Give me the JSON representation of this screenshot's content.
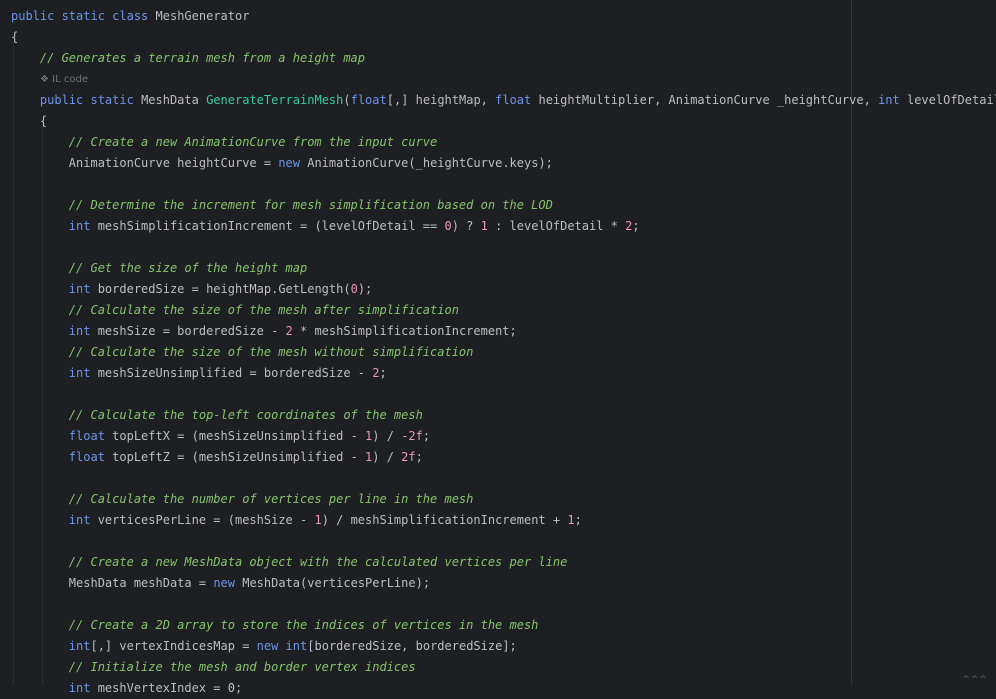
{
  "editor": {
    "inline_hint": {
      "icon": "il-code-icon",
      "label": "IL code"
    },
    "footer_marker": "^^^",
    "lines": [
      [
        [
          "kw",
          "public "
        ],
        [
          "kw",
          "static "
        ],
        [
          "kw",
          "class "
        ],
        [
          "type",
          "MeshGenerator"
        ]
      ],
      [
        [
          "punct",
          "{"
        ]
      ],
      [
        [
          "cmt",
          "    // Generates a terrain mesh from a height map"
        ]
      ],
      "HINT",
      [
        [
          "ident",
          "    "
        ],
        [
          "kw",
          "public "
        ],
        [
          "kw",
          "static "
        ],
        [
          "type",
          "MeshData "
        ],
        [
          "fn",
          "GenerateTerrainMesh"
        ],
        [
          "punct",
          "("
        ],
        [
          "kw",
          "float"
        ],
        [
          "punct",
          "[,] "
        ],
        [
          "ident",
          "heightMap, "
        ],
        [
          "kw",
          "float "
        ],
        [
          "ident",
          "heightMultiplier, "
        ],
        [
          "type",
          "AnimationCurve "
        ],
        [
          "ident",
          "_heightCurve, "
        ],
        [
          "kw",
          "int "
        ],
        [
          "ident",
          "levelOfDetail)"
        ]
      ],
      [
        [
          "punct",
          "    {"
        ]
      ],
      [
        [
          "cmt",
          "        // Create a new AnimationCurve from the input curve"
        ]
      ],
      [
        [
          "ident",
          "        "
        ],
        [
          "type",
          "AnimationCurve "
        ],
        [
          "ident",
          "heightCurve = "
        ],
        [
          "kw",
          "new "
        ],
        [
          "type",
          "AnimationCurve"
        ],
        [
          "punct",
          "("
        ],
        [
          "ident",
          "_heightCurve.keys);"
        ]
      ],
      [],
      [
        [
          "cmt",
          "        // Determine the increment for mesh simplification based on the LOD"
        ]
      ],
      [
        [
          "ident",
          "        "
        ],
        [
          "kw",
          "int "
        ],
        [
          "ident",
          "meshSimplificationIncrement = (levelOfDetail == "
        ],
        [
          "num",
          "0"
        ],
        [
          "ident",
          ") ? "
        ],
        [
          "num",
          "1"
        ],
        [
          "ident",
          " : levelOfDetail * "
        ],
        [
          "num",
          "2"
        ],
        [
          "ident",
          ";"
        ]
      ],
      [],
      [
        [
          "cmt",
          "        // Get the size of the height map"
        ]
      ],
      [
        [
          "ident",
          "        "
        ],
        [
          "kw",
          "int "
        ],
        [
          "ident",
          "borderedSize = heightMap.GetLength("
        ],
        [
          "num",
          "0"
        ],
        [
          "ident",
          ");"
        ]
      ],
      [
        [
          "cmt",
          "        // Calculate the size of the mesh after simplification"
        ]
      ],
      [
        [
          "ident",
          "        "
        ],
        [
          "kw",
          "int "
        ],
        [
          "ident",
          "meshSize = borderedSize - "
        ],
        [
          "num",
          "2"
        ],
        [
          "ident",
          " * meshSimplificationIncrement;"
        ]
      ],
      [
        [
          "cmt",
          "        // Calculate the size of the mesh without simplification"
        ]
      ],
      [
        [
          "ident",
          "        "
        ],
        [
          "kw",
          "int "
        ],
        [
          "ident",
          "meshSizeUnsimplified = borderedSize - "
        ],
        [
          "num",
          "2"
        ],
        [
          "ident",
          ";"
        ]
      ],
      [],
      [
        [
          "cmt",
          "        // Calculate the top-left coordinates of the mesh"
        ]
      ],
      [
        [
          "ident",
          "        "
        ],
        [
          "kw",
          "float "
        ],
        [
          "ident",
          "topLeftX = (meshSizeUnsimplified - "
        ],
        [
          "num",
          "1"
        ],
        [
          "ident",
          ") / "
        ],
        [
          "num",
          "-2f"
        ],
        [
          "ident",
          ";"
        ]
      ],
      [
        [
          "ident",
          "        "
        ],
        [
          "kw",
          "float "
        ],
        [
          "ident",
          "topLeftZ = (meshSizeUnsimplified - "
        ],
        [
          "num",
          "1"
        ],
        [
          "ident",
          ") / "
        ],
        [
          "num",
          "2f"
        ],
        [
          "ident",
          ";"
        ]
      ],
      [],
      [
        [
          "cmt",
          "        // Calculate the number of vertices per line in the mesh"
        ]
      ],
      [
        [
          "ident",
          "        "
        ],
        [
          "kw",
          "int "
        ],
        [
          "ident",
          "verticesPerLine = (meshSize - "
        ],
        [
          "num",
          "1"
        ],
        [
          "ident",
          ") / meshSimplificationIncrement + "
        ],
        [
          "num",
          "1"
        ],
        [
          "ident",
          ";"
        ]
      ],
      [],
      [
        [
          "cmt",
          "        // Create a new MeshData object with the calculated vertices per line"
        ]
      ],
      [
        [
          "ident",
          "        "
        ],
        [
          "type",
          "MeshData "
        ],
        [
          "ident",
          "meshData = "
        ],
        [
          "kw",
          "new "
        ],
        [
          "type",
          "MeshData"
        ],
        [
          "ident",
          "(verticesPerLine);"
        ]
      ],
      [],
      [
        [
          "cmt",
          "        // Create a 2D array to store the indices of vertices in the mesh"
        ]
      ],
      [
        [
          "ident",
          "        "
        ],
        [
          "kw",
          "int"
        ],
        [
          "punct",
          "[,] "
        ],
        [
          "ident",
          "vertexIndicesMap = "
        ],
        [
          "kw",
          "new "
        ],
        [
          "kw",
          "int"
        ],
        [
          "ident",
          "[borderedSize, borderedSize];"
        ]
      ],
      [
        [
          "cmt",
          "        // Initialize the mesh and border vertex indices"
        ]
      ],
      [
        [
          "ident",
          "        "
        ],
        [
          "kw",
          "int "
        ],
        [
          "ident",
          "meshVertexIndex = 0;"
        ]
      ]
    ]
  }
}
